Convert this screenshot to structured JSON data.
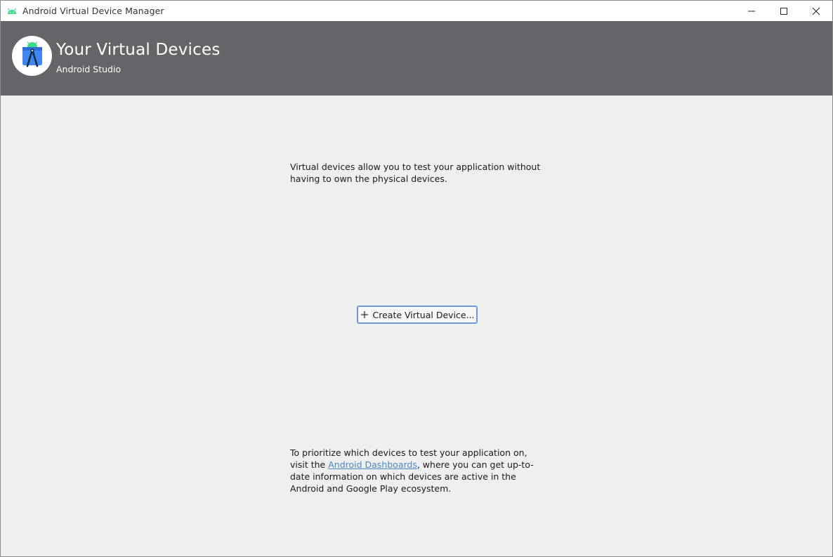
{
  "window": {
    "title": "Android Virtual Device Manager"
  },
  "header": {
    "title": "Your Virtual Devices",
    "subtitle": "Android Studio"
  },
  "content": {
    "description": "Virtual devices allow you to test your application without having to own the physical devices.",
    "create_button_label": "Create Virtual Device...",
    "info_prefix": "To prioritize which devices to test your application on, visit the ",
    "info_link": "Android Dashboards",
    "info_suffix": ", where you can get up-to-date information on which devices are active in the Android and Google Play ecosystem."
  },
  "icons": {
    "app": "android-icon",
    "logo": "android-studio-logo-icon",
    "minimize": "minimize-icon",
    "maximize": "maximize-icon",
    "close": "close-icon",
    "add": "plus-icon"
  },
  "colors": {
    "header_bg": "#646569",
    "content_bg": "#efefef",
    "link": "#4a86c7",
    "button_focus": "#6b9ad6",
    "android_green": "#3ddc84"
  }
}
